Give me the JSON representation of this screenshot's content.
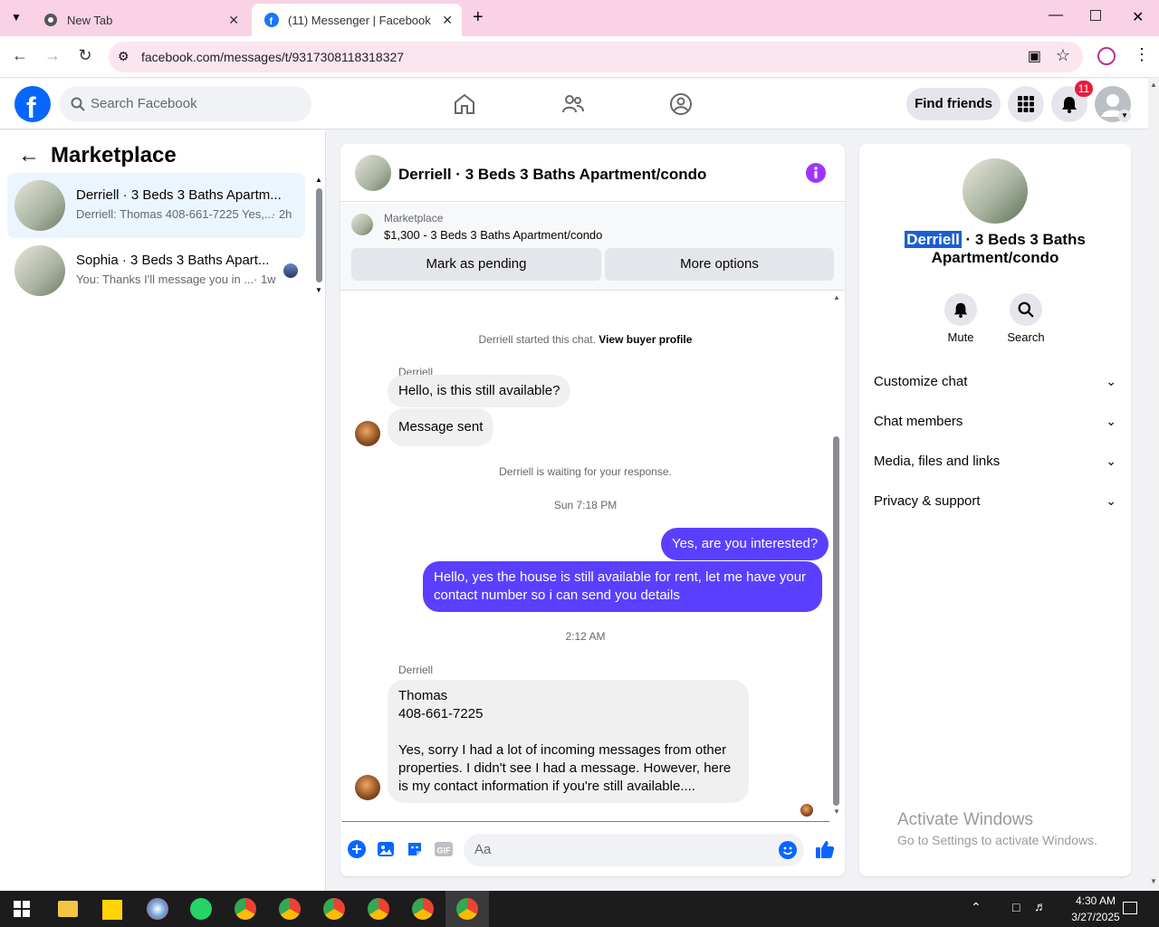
{
  "browser": {
    "tabs": [
      {
        "label": "New Tab",
        "active": false
      },
      {
        "label": "(11) Messenger | Facebook",
        "active": true
      }
    ],
    "url": "facebook.com/messages/t/9317308118318327"
  },
  "fbheader": {
    "search_placeholder": "Search Facebook",
    "find_friends": "Find friends",
    "notif_count": "11"
  },
  "left": {
    "title": "Marketplace",
    "conversations": [
      {
        "name": "Derriell · 3 Beds 3 Baths Apartm...",
        "preview": "Derriell: Thomas 408-661-7225 Yes,...",
        "time": "· 2h"
      },
      {
        "name": "Sophia · 3 Beds 3 Baths Apart...",
        "preview": "You: Thanks I'll message you in ...",
        "time": "· 1w"
      }
    ]
  },
  "chat": {
    "title": "Derriell · 3 Beds 3 Baths Apartment/condo",
    "listing_label": "Marketplace",
    "listing_detail": "$1,300 - 3 Beds 3 Baths Apartment/condo",
    "mark_pending": "Mark as pending",
    "more_options": "More options",
    "started_text": "Derriell started this chat.",
    "view_buyer": "View buyer profile",
    "sender1": "Derriell",
    "msg1": "Hello, is this still available?",
    "msg2": "Message sent",
    "waiting": "Derriell is waiting for your response.",
    "time1": "Sun 7:18 PM",
    "out1": "Yes, are you interested?",
    "out2": "Hello, yes the house is still available for rent, let me have your contact number so i can send you  details",
    "time2": "2:12 AM",
    "sender2": "Derriell",
    "msg3_l1": "Thomas",
    "msg3_l2": "408-661-7225",
    "msg3_l3": "Yes, sorry I had a lot of incoming messages from other properties. I didn't see I had a message. However, here is my contact information if you're still available....",
    "input_placeholder": "Aa"
  },
  "right": {
    "name_highlight": "Derriell",
    "name_rest": " · 3 Beds 3 Baths",
    "name_line2": "Apartment/condo",
    "mute": "Mute",
    "search": "Search",
    "sections": [
      "Customize chat",
      "Chat members",
      "Media, files and links",
      "Privacy & support"
    ],
    "activate_title": "Activate Windows",
    "activate_sub": "Go to Settings to activate Windows."
  },
  "taskbar": {
    "time": "4:30 AM",
    "date": "3/27/2025"
  }
}
